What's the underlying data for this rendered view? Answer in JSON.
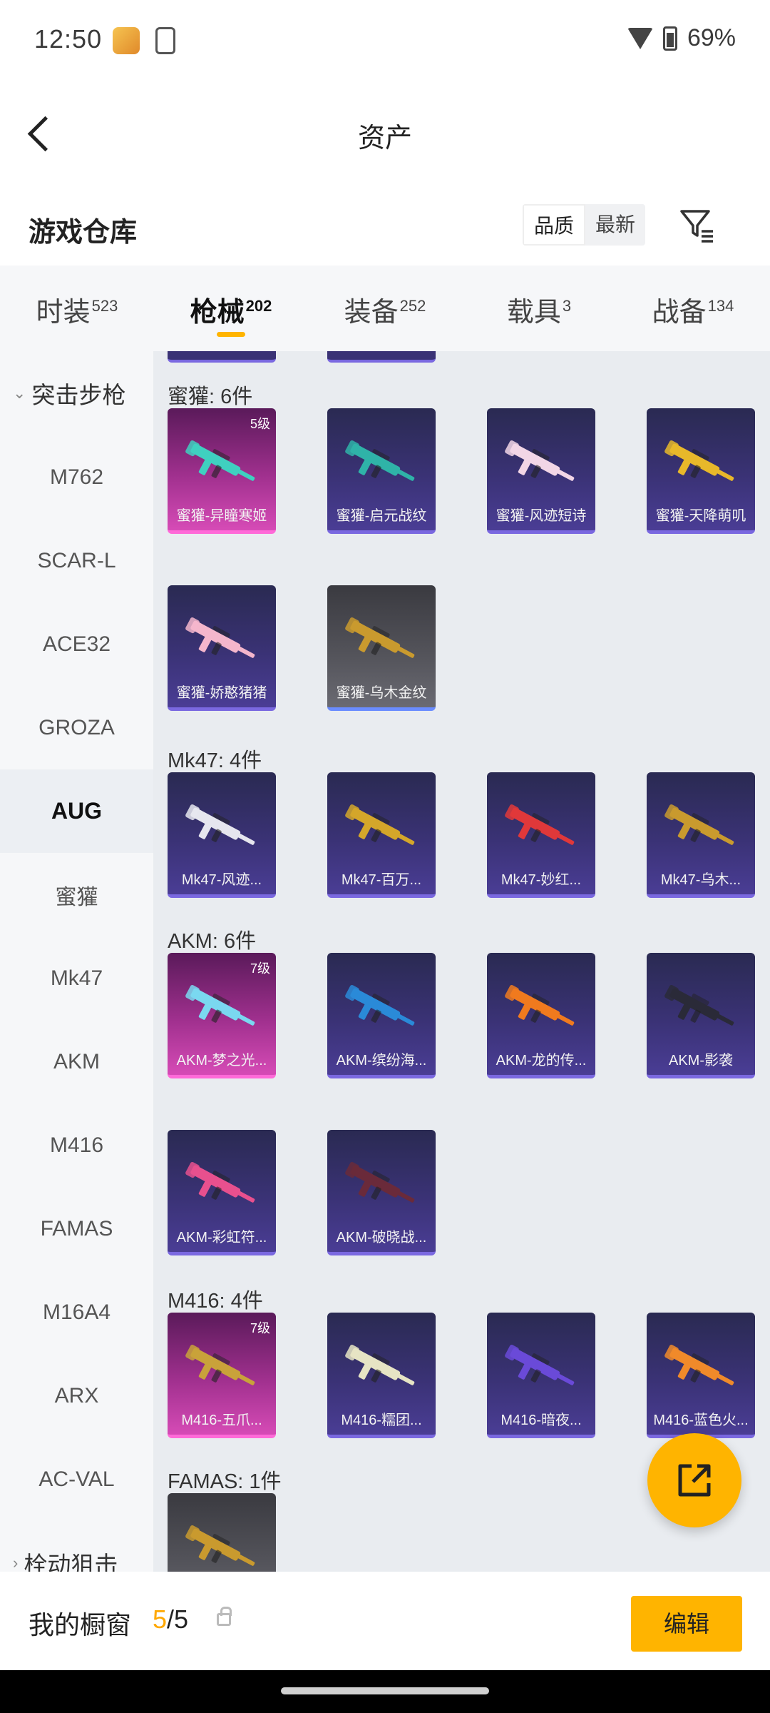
{
  "status_bar": {
    "time": "12:50",
    "battery": "69%"
  },
  "header": {
    "title": "资产"
  },
  "warehouse": {
    "title": "游戏仓库",
    "sort_options": [
      "品质",
      "最新"
    ]
  },
  "tabs": [
    {
      "label": "时装",
      "count": "523"
    },
    {
      "label": "枪械",
      "count": "202"
    },
    {
      "label": "装备",
      "count": "252"
    },
    {
      "label": "载具",
      "count": "3"
    },
    {
      "label": "战备",
      "count": "134"
    }
  ],
  "sidebar": {
    "category_top": "突击步枪",
    "items": [
      "M762",
      "SCAR-L",
      "ACE32",
      "GROZA",
      "AUG",
      "蜜獾",
      "Mk47",
      "AKM",
      "M416",
      "FAMAS",
      "M16A4",
      "ARX",
      "AC-VAL"
    ],
    "active_item": "AUG",
    "category_bottom": "栓动狙击"
  },
  "sections": [
    {
      "title": "蜜獾: 6件",
      "items": [
        {
          "label": "蜜獾-异瞳寒姬",
          "level": "5级",
          "rarity": "legend",
          "gun_color": "#3fd0c0"
        },
        {
          "label": "蜜獾-启元战纹",
          "level": "",
          "rarity": "epic",
          "gun_color": "#2fb3a8"
        },
        {
          "label": "蜜獾-风迹短诗",
          "level": "",
          "rarity": "epic",
          "gun_color": "#f2d6e6"
        },
        {
          "label": "蜜獾-天降萌叽",
          "level": "",
          "rarity": "epic",
          "gun_color": "#e8b82a"
        },
        {
          "label": "蜜獾-娇憨猪猪",
          "level": "",
          "rarity": "epic",
          "gun_color": "#f4b6cc"
        },
        {
          "label": "蜜獾-乌木金纹",
          "level": "",
          "rarity": "grey",
          "gun_color": "#c99a2e"
        }
      ]
    },
    {
      "title": "Mk47: 4件",
      "items": [
        {
          "label": "Mk47-风迹...",
          "level": "",
          "rarity": "epic",
          "gun_color": "#e6e6ee"
        },
        {
          "label": "Mk47-百万...",
          "level": "",
          "rarity": "epic",
          "gun_color": "#d4a62a"
        },
        {
          "label": "Mk47-妙红...",
          "level": "",
          "rarity": "epic",
          "gun_color": "#e0383a"
        },
        {
          "label": "Mk47-乌木...",
          "level": "",
          "rarity": "epic",
          "gun_color": "#c99a2e"
        }
      ]
    },
    {
      "title": "AKM: 6件",
      "items": [
        {
          "label": "AKM-梦之光...",
          "level": "7级",
          "rarity": "legend",
          "gun_color": "#7ad8f0"
        },
        {
          "label": "AKM-缤纷海...",
          "level": "",
          "rarity": "epic",
          "gun_color": "#2a8ad8"
        },
        {
          "label": "AKM-龙的传...",
          "level": "",
          "rarity": "epic",
          "gun_color": "#f07a1e"
        },
        {
          "label": "AKM-影袭",
          "level": "",
          "rarity": "epic",
          "gun_color": "#2a2a38"
        },
        {
          "label": "AKM-彩虹符...",
          "level": "",
          "rarity": "epic",
          "gun_color": "#e8508e"
        },
        {
          "label": "AKM-破晓战...",
          "level": "",
          "rarity": "epic",
          "gun_color": "#6a2a3a"
        }
      ]
    },
    {
      "title": "M416: 4件",
      "items": [
        {
          "label": "M416-五爪...",
          "level": "7级",
          "rarity": "legend",
          "gun_color": "#c9a23a"
        },
        {
          "label": "M416-糯团...",
          "level": "",
          "rarity": "epic",
          "gun_color": "#e6e4c4"
        },
        {
          "label": "M416-暗夜...",
          "level": "",
          "rarity": "epic",
          "gun_color": "#6a4ad8"
        },
        {
          "label": "M416-蓝色火...",
          "level": "",
          "rarity": "epic",
          "gun_color": "#f08a2a"
        }
      ]
    },
    {
      "title": "FAMAS: 1件",
      "items": [
        {
          "label": "",
          "level": "",
          "rarity": "grey",
          "gun_color": "#c99a2e"
        }
      ]
    }
  ],
  "bottom": {
    "label": "我的橱窗",
    "current": "5",
    "total": "/5",
    "edit_label": "编辑"
  },
  "colors": {
    "accent": "#ffb400",
    "legend": "#d64bb6",
    "epic": "#4a3d95"
  }
}
